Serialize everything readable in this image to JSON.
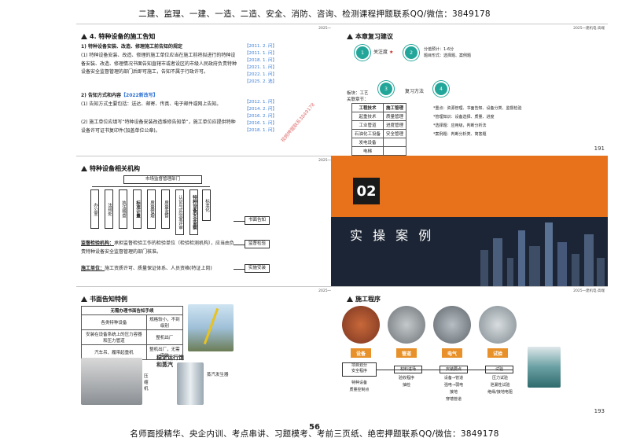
{
  "top_banner": "二建、监理、一建、一造、二造、安全、消防、咨询、检测课程押题联系QQ/微信：3849178",
  "bottom_banner": "名师面授精华、央企内训、考点串讲、习题模考、考前三页纸、绝密押题联系QQ/微信：3849178",
  "page_number_overlay": "56",
  "slide_header": "2025一建机电·高端",
  "watermark": "视频押题联系3849178",
  "slide188": {
    "title": "4. 特种设备的施工告知",
    "sub1": "1) 特种设备安装、改造、修理施工前告知的规定",
    "p1": "(1) 特种设备安装、改造、修理的施工单位应当在施工前将拟进行的特种设备安装、改造、修理情况书面告知直辖市或者设区的市级人民政府负责特种设备安全监督管理的部门后即可施工，告知不属于行政许可。",
    "sub2": "2) 告知方式和内容",
    "sub2_tag": "【2022新改写】",
    "p2": "(1) 告知方式主要包括：送达、邮寄、传真、电子邮件或网上告知。",
    "p3": "(2) 施工单位应填写“特种设备安装改造维修告知单”，施工单位应提供特种设备许可证书复印件(加盖单位公章)。",
    "refs1": [
      "【2011. 2. 问】",
      "【2011. 1. 问】",
      "【2018. 1. 问】",
      "【2021. 1. 问】",
      "【2022. 1. 问】",
      "【2025. 2. 选】"
    ],
    "refs2": [
      "【2012. 1. 问】",
      "【2014. 2. 问】",
      "【2016. 2. 问】",
      "【2016. 1. 问】",
      "【2018. 1. 问】"
    ],
    "page": "188"
  },
  "slide189": {
    "title": "特种设备相关机构",
    "top_box": "市场监督管理部门",
    "orgs": [
      "办公室",
      "法规处",
      "执法稽查",
      "标准计量",
      "质量管理",
      "质量监督",
      "认证与实验室评审",
      "特种设备安全监察",
      "标准化"
    ],
    "notice_box": "书面告知",
    "inspect_box": "监督检验",
    "acceptance_box": "实施安装",
    "p1_lead": "监督检验机构：",
    "p1": "承担监督检验工作的检验单位（检验检测机构），应当由负责特种设备安全监督管理的部门核准。",
    "p2_lead": "施工单位：",
    "p2": "施工资质许可、质量保证体系、人员资格(特证上岗)",
    "page": "189"
  },
  "slide190": {
    "title": "书面告知特例",
    "table_header": "无需办理书面告知手续",
    "rows": [
      [
        "各类特种设备",
        "规格较小，不到级别"
      ],
      [
        "安装在设备系统上的压力容器和压力管道",
        "整机出厂"
      ],
      [
        "汽车吊、履带起重机",
        "整机出厂，无需安装"
      ]
    ],
    "label_pressure": "压缩机",
    "label_steam_title": "稳定运行饱和蒸汽",
    "label_steam": "蒸汽发生器",
    "page": "190"
  },
  "slide191": {
    "title": "本章复习建议",
    "step1": "关注度",
    "step2": "分值预计：1-6分",
    "step2b": "题目形式：选择题、案例题",
    "step3": "复习方法",
    "step4_label": "板块：工艺",
    "step4_sub": "关联章节：",
    "circles": [
      "1",
      "2",
      "3",
      "4"
    ],
    "table": [
      [
        "工程技术",
        "施工管理"
      ],
      [
        "起重技术",
        "质量管理"
      ],
      [
        "工业管道",
        "进度管理"
      ],
      [
        "石油化工设备",
        "安全管理"
      ],
      [
        "发电设备",
        ""
      ],
      [
        "电梯",
        ""
      ]
    ],
    "bullets": [
      "*重点：资源管理、书面告知、设备分类、监督检验",
      "*管理知识：设备选择、质量、进度",
      "*选择题：应用级，判断分析法",
      "*案例题：判断分析类、简答题"
    ],
    "page": "191"
  },
  "slide192": {
    "number": "02",
    "title": "实 操 案 例",
    "colors": {
      "orange": "#e8721c",
      "dark": "#1c2535"
    }
  },
  "slide193": {
    "title": "施工程序",
    "tags": [
      "设备",
      "管道",
      "电气",
      "试验"
    ],
    "steps": [
      "项目划分\n安全程序",
      "材料进场",
      "安装要点",
      "试验"
    ],
    "col1": [
      "特种设备",
      "质量控制点"
    ],
    "col2": [
      "验收程序",
      "抽检"
    ],
    "col3": [
      "设备→管道",
      "强电→弱电",
      "接地",
      "穿墙管道"
    ],
    "col4": [
      "压力试验",
      "泄漏性试验",
      "绝缘/接地电阻"
    ],
    "page": "193"
  }
}
